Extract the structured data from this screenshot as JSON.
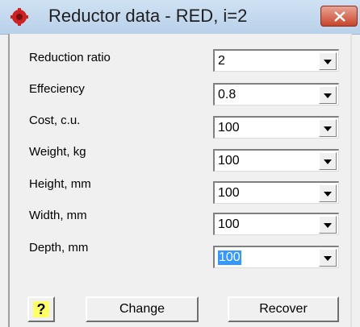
{
  "window": {
    "title": "Reductor data - RED, i=2"
  },
  "fields": [
    {
      "label": "Reduction ratio",
      "value": "2"
    },
    {
      "label": "Effeciency",
      "value": "0.8"
    },
    {
      "label": "Cost, c.u.",
      "value": "100"
    },
    {
      "label": "Weight, kg",
      "value": "100"
    },
    {
      "label": "Height, mm",
      "value": "100"
    },
    {
      "label": "Width, mm",
      "value": "100"
    },
    {
      "label": "Depth, mm",
      "value": "100",
      "selected": true
    }
  ],
  "buttons": {
    "help": "?",
    "change": "Change",
    "recover": "Recover"
  },
  "icons": {
    "app": "red-gear-icon",
    "close": "close-icon",
    "dropdown": "chevron-down-icon"
  },
  "colors": {
    "selection": "#3399ff",
    "close_button": "#c7452c",
    "help_background": "#ffff66",
    "app_icon": "#cc2222"
  }
}
